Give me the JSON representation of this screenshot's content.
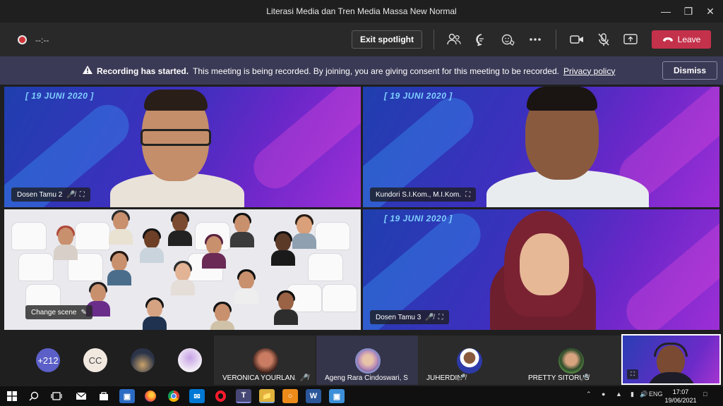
{
  "window": {
    "title": "Literasi Media dan Tren Media Massa New Normal"
  },
  "toolbar": {
    "timer": "--:--",
    "exit_spotlight": "Exit spotlight",
    "leave": "Leave"
  },
  "banner": {
    "bold": "Recording has started.",
    "text": "This meeting is being recorded. By joining, you are giving consent for this meeting to be recorded.",
    "link": "Privacy policy",
    "dismiss": "Dismiss"
  },
  "tiles": [
    {
      "name": "Dosen Tamu 2",
      "date": "[ 19 JUNI 2020 ]"
    },
    {
      "name": "Kundori S.I.Kom., M.I.Kom.",
      "date": "[ 19 JUNI 2020 ]"
    },
    {
      "name": "Change scene"
    },
    {
      "name": "Dosen Tamu 3",
      "date": "[ 19 JUNI 2020 ]"
    }
  ],
  "strip": {
    "overflow_count": "+212",
    "cc_initials": "CC",
    "participants": [
      {
        "name": "VERONICA YOURLAN..."
      },
      {
        "name": "Ageng Rara Cindoswari, S...."
      },
      {
        "name": "JUHERDIN"
      },
      {
        "name": "PRETTY SITORUS"
      }
    ]
  },
  "taskbar": {
    "lang": "ENG",
    "time": "17:07",
    "date": "19/06/2021"
  },
  "colors": {
    "leave": "#c4314b",
    "banner": "#3b3a56",
    "accent_purple": "#6b27c9"
  }
}
